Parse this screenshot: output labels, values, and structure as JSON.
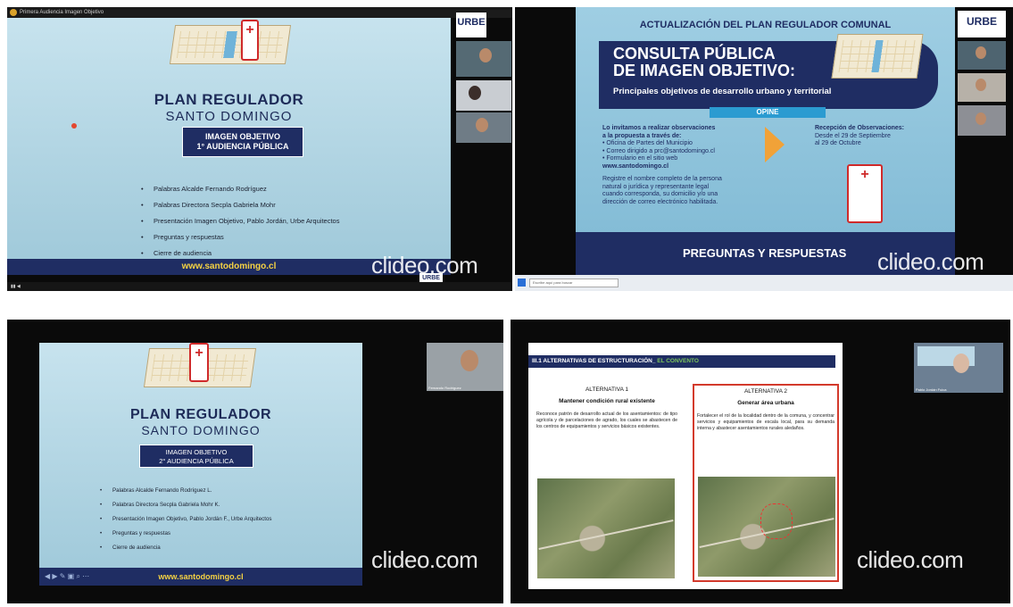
{
  "panel1": {
    "window_title": "Primera Audiencia Imagen Objetivo",
    "slide": {
      "title": "PLAN REGULADOR",
      "subtitle": "SANTO DOMINGO",
      "badge_line1": "IMAGEN OBJETIVO",
      "badge_line2": "1° AUDIENCIA PÚBLICA",
      "bullets": [
        "Palabras Alcalde Fernando Rodríguez",
        "Palabras Directora Secpla Gabriela Mohr",
        "Presentación Imagen Objetivo, Pablo Jordán, Urbe Arquitectos",
        "Preguntas y respuestas",
        "Cierre de audiencia"
      ],
      "url": "www.santodomingo.cl"
    },
    "logo_text": "URBE",
    "watermark": "clideo.com"
  },
  "panel2": {
    "header": "ACTUALIZACIÓN DEL PLAN REGULADOR COMUNAL",
    "big_line1": "CONSULTA PÚBLICA",
    "big_line2": "DE IMAGEN OBJETIVO:",
    "small_line": "Principales objetivos de desarrollo urbano y territorial",
    "opine": "OPINE",
    "left_col": {
      "intro1": "Lo invitamos a realizar observaciones",
      "intro2": "a la propuesta a través de:",
      "item1": "• Oficina de Partes del Municipio",
      "item2": "• Correo dirigido a prc@santodomingo.cl",
      "item3": "• Formulario en el sitio web",
      "url": "www.santodomingo.cl",
      "note1": "Registre el nombre completo de la persona",
      "note2": "natural o jurídica y representante legal",
      "note3": "cuando corresponda, su domicilio y/o una",
      "note4": "dirección de correo electrónico habilitada."
    },
    "right_col": {
      "title": "Recepción de Observaciones:",
      "line1": "Desde el 29 de Septiembre",
      "line2": "al 29 de Octubre"
    },
    "footer": "PREGUNTAS Y RESPUESTAS",
    "logo_text": "URBE",
    "watermark": "clideo.com",
    "taskbar_search": "Escribe aquí para buscar"
  },
  "panel3": {
    "slide": {
      "title": "PLAN REGULADOR",
      "subtitle": "SANTO DOMINGO",
      "badge_line1": "IMAGEN OBJETIVO",
      "badge_line2": "2° AUDIENCIA PÚBLICA",
      "bullets": [
        "Palabras Alcalde Fernando Rodríguez L.",
        "Palabras Directora Secpla Gabriela Mohr K.",
        "Presentación Imagen Objetivo, Pablo Jordán F., Urbe Arquitectos",
        "Preguntas y respuestas",
        "Cierre de audiencia"
      ],
      "url": "www.santodomingo.cl"
    },
    "cam_caption": "Fernando Rodríguez",
    "watermark": "clideo.com"
  },
  "panel4": {
    "slide_title_prefix": "III.1 ALTERNATIVAS DE ESTRUCTURACIÓN_",
    "slide_title_highlight": " EL CONVENTO",
    "alt1": {
      "title": "ALTERNATIVA 1",
      "subtitle": "Mantener condición rural existente",
      "text": "Reconoce patrón de desarrollo actual de los asentamientos: de tipo agrícola y de parcelaciones de agrado, los cuales se abastecen de los centros de equipamientos y servicios básicos existentes."
    },
    "alt2": {
      "title": "ALTERNATIVA 2",
      "subtitle": "Generar área urbana",
      "text": "Fortalecer el rol de la localidad dentro de la comuna, y concentrar servicios y equipamientos de escala local, para su demanda interna y abastecer asentamientos rurales aledaños."
    },
    "cam_caption": "Pablo Jordán Fuica",
    "watermark": "clideo.com"
  },
  "colors": {
    "navy": "#1f2d63",
    "slide_blue": "#a8d2e3",
    "url_yellow": "#f5d243",
    "accent_orange": "#f1a238",
    "highlight_green": "#7cc45c",
    "alt2_border": "#d33a2c"
  }
}
